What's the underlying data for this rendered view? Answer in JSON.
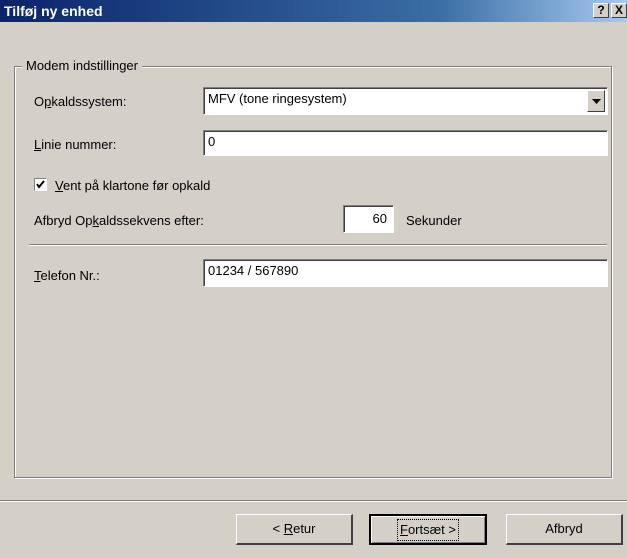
{
  "window": {
    "title": "Tilføj ny enhed",
    "help_glyph": "?",
    "close_glyph": "X"
  },
  "group": {
    "legend": "Modem indstillinger"
  },
  "dialing": {
    "label_pre": "O",
    "label_key": "p",
    "label_post": "kaldssystem:",
    "selected": "MFV (tone ringesystem)"
  },
  "line": {
    "label_key": "L",
    "label_post": "inie nummer:",
    "value": "0"
  },
  "wait_tone": {
    "label_key": "V",
    "label_post": "ent på klartone før opkald",
    "checked": true
  },
  "abort": {
    "label_pre": "Afbryd Op",
    "label_key": "k",
    "label_post": "aldssekvens efter:",
    "value": "60",
    "unit": "Sekunder"
  },
  "phone": {
    "label_key": "T",
    "label_post": "elefon Nr.:",
    "value": "01234 / 567890"
  },
  "buttons": {
    "back_pre": "< ",
    "back_key": "R",
    "back_post": "etur",
    "next_key": "F",
    "next_post": "ortsæt >",
    "cancel": "Afbryd"
  }
}
